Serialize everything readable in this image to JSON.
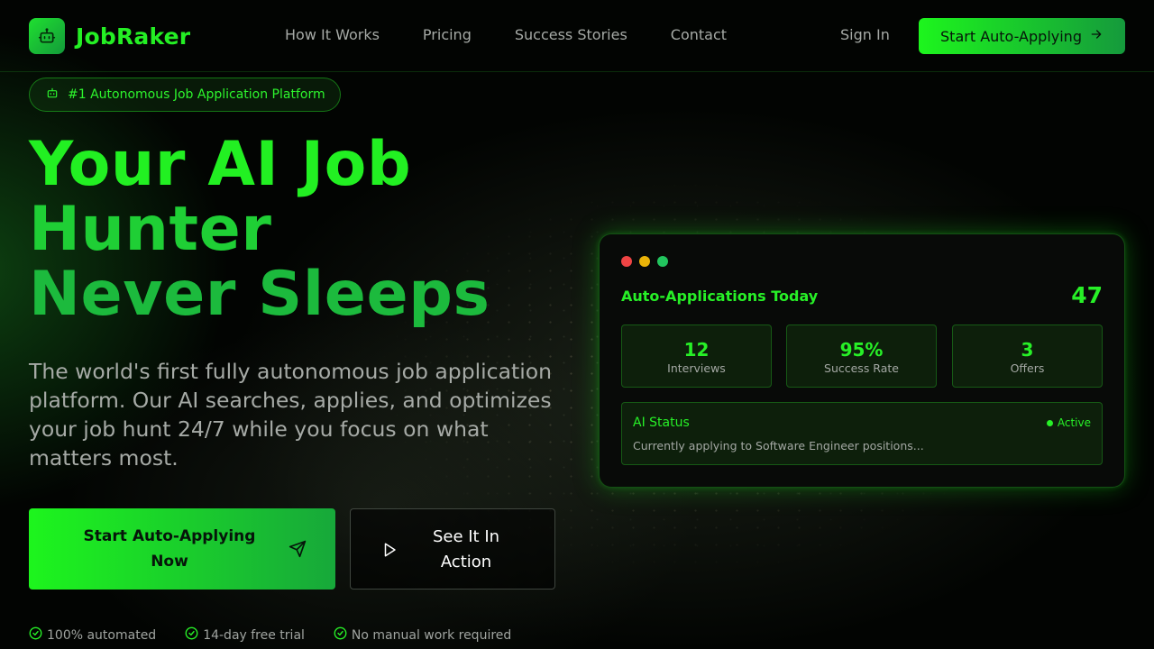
{
  "brand": {
    "name": "JobRaker",
    "logo_icon": "robot-icon"
  },
  "nav": {
    "links": [
      "How It Works",
      "Pricing",
      "Success Stories",
      "Contact"
    ],
    "sign_in": "Sign In",
    "cta": "Start Auto-Applying"
  },
  "hero": {
    "badge": "#1 Autonomous Job Application Platform",
    "headline": [
      "Your AI Job",
      "Hunter",
      "Never Sleeps"
    ],
    "subtitle": "The world's first fully autonomous job application platform. Our AI searches, applies, and optimizes your job hunt 24/7 while you focus on what matters most.",
    "primary_button": "Start Auto-Applying Now",
    "secondary_button": "See It In Action",
    "features": [
      "100% automated",
      "14-day free trial",
      "No manual work required"
    ]
  },
  "dashboard": {
    "title": "Auto-Applications Today",
    "count": "47",
    "stats": [
      {
        "value": "12",
        "label": "Interviews"
      },
      {
        "value": "95%",
        "label": "Success Rate"
      },
      {
        "value": "3",
        "label": "Offers"
      }
    ],
    "status": {
      "label": "AI Status",
      "state": "Active",
      "description": "Currently applying to Software Engineer positions..."
    },
    "window_dot_colors": [
      "#ef4444",
      "#eab308",
      "#22c55e"
    ]
  },
  "colors": {
    "accent": "#22f022",
    "accent_dark": "#159a3c",
    "background": "#020402"
  }
}
